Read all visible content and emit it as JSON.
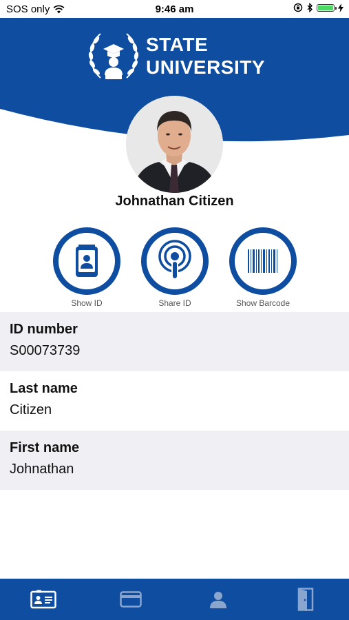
{
  "status_bar": {
    "carrier": "SOS only",
    "time": "9:46 am"
  },
  "header": {
    "title_line1": "STATE",
    "title_line2": "UNIVERSITY",
    "brand_color": "#0e4d9f"
  },
  "profile": {
    "name": "Johnathan Citizen"
  },
  "actions": [
    {
      "label": "Show ID",
      "icon": "id-card-icon"
    },
    {
      "label": "Share ID",
      "icon": "broadcast-icon"
    },
    {
      "label": "Show Barcode",
      "icon": "barcode-icon"
    }
  ],
  "fields": [
    {
      "label": "ID number",
      "value": "S00073739"
    },
    {
      "label": "Last name",
      "value": "Citizen"
    },
    {
      "label": "First name",
      "value": "Johnathan"
    }
  ],
  "tab_bar": {
    "tabs": [
      {
        "icon": "id-card-tab-icon",
        "active": true
      },
      {
        "icon": "credit-card-tab-icon",
        "active": false
      },
      {
        "icon": "profile-tab-icon",
        "active": false
      },
      {
        "icon": "logout-door-tab-icon",
        "active": false
      }
    ]
  }
}
